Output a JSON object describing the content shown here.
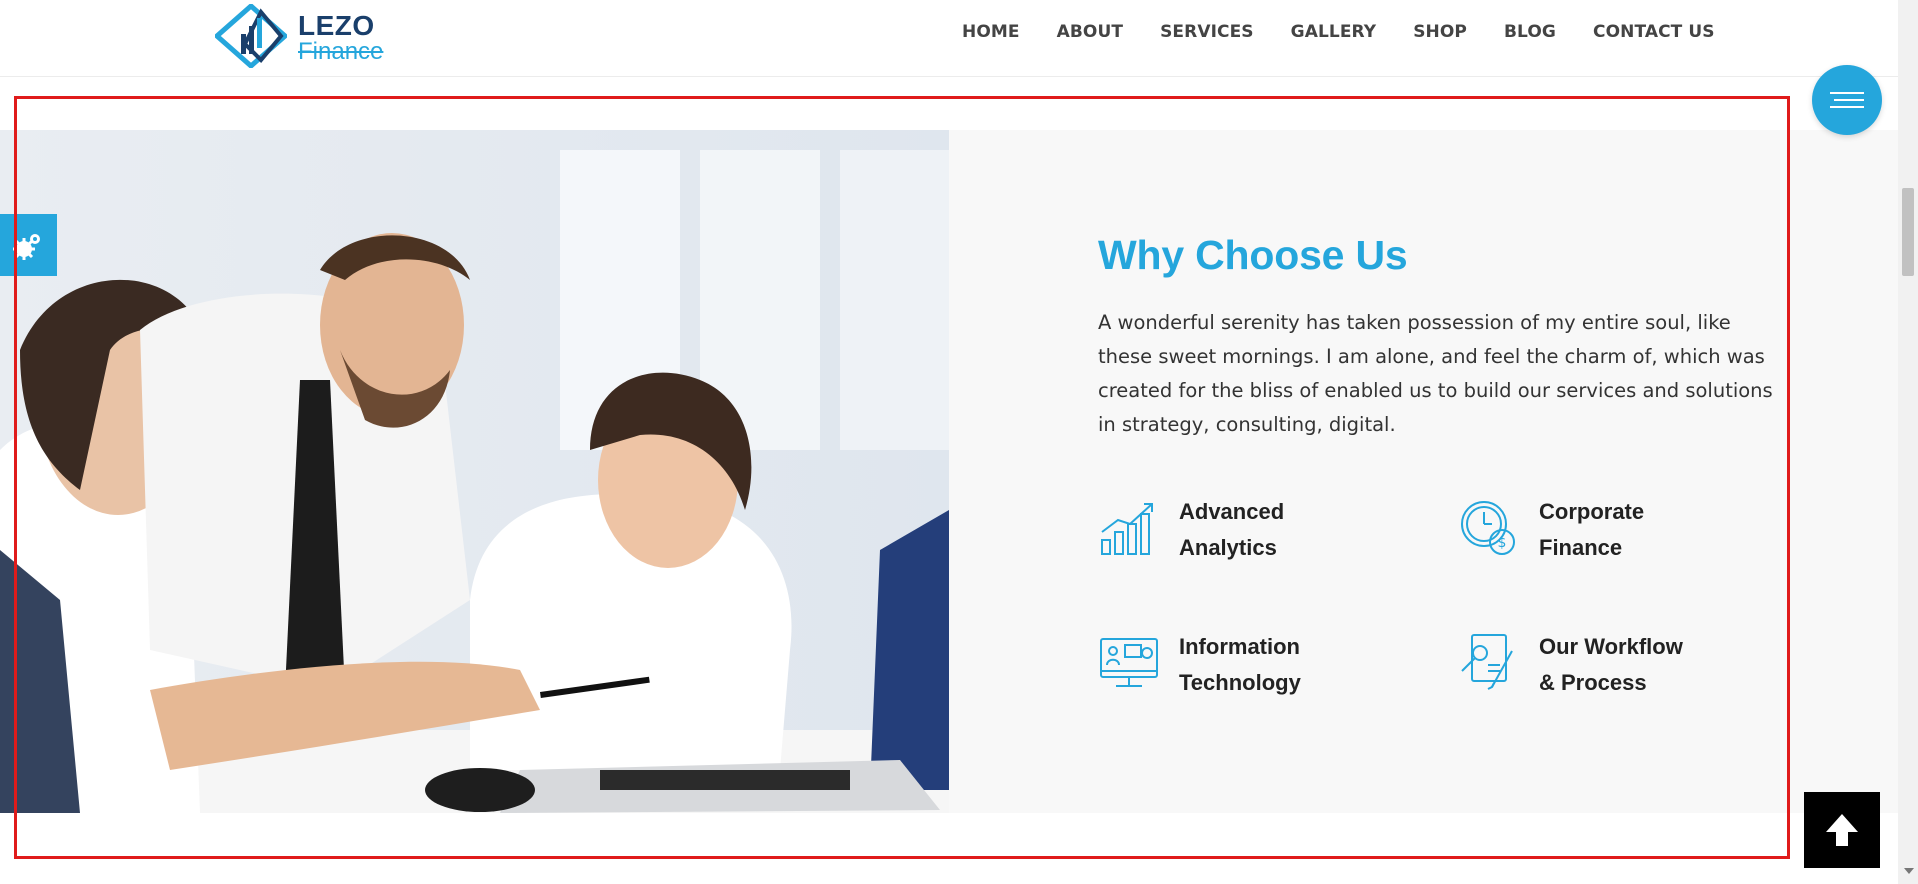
{
  "logo": {
    "line1": "LEZO",
    "line2": "Finance"
  },
  "nav": {
    "items": [
      "HOME",
      "ABOUT",
      "SERVICES",
      "GALLERY",
      "SHOP",
      "BLOG",
      "CONTACT US"
    ]
  },
  "section": {
    "heading": "Why Choose Us",
    "paragraph": "A wonderful serenity has taken possession of my entire soul, like these sweet mornings. I am alone, and feel the charm of, which was created for the bliss of enabled us to build our services and solutions in strategy, consulting, digital.",
    "features": [
      {
        "line1": "Advanced",
        "line2": "Analytics",
        "icon": "analytics-chart-icon"
      },
      {
        "line1": "Corporate",
        "line2": "Finance",
        "icon": "clock-coin-icon"
      },
      {
        "line1": "Information",
        "line2": "Technology",
        "icon": "monitor-presentation-icon"
      },
      {
        "line1": "Our Workflow",
        "line2": "& Process",
        "icon": "workflow-document-icon"
      }
    ]
  },
  "colors": {
    "accent": "#25a6dc",
    "frame": "#e01b1b",
    "section_bg": "#f8f8f8"
  },
  "icons": {
    "menu": "hamburger-menu-icon",
    "settings": "gears-icon",
    "back_to_top": "arrow-up-icon"
  }
}
